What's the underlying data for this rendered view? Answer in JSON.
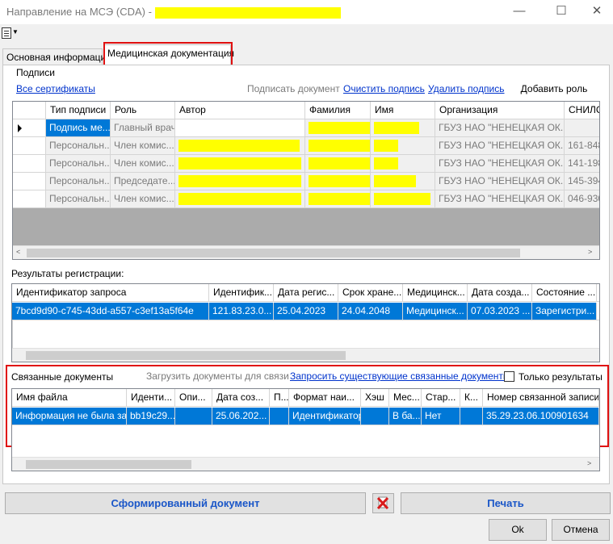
{
  "window": {
    "title": "Направление на МСЭ (CDA) -",
    "minimize": "—",
    "maximize": "☐",
    "close": "✕"
  },
  "tabs": [
    {
      "label": "Основная информация",
      "active": false
    },
    {
      "label": "Медицинская документация",
      "active": true
    }
  ],
  "signatures": {
    "group_title": "Подписи",
    "all_certificates": "Все сертификаты",
    "sign_document": "Подписать документ",
    "clear_signature": "Очистить подпись",
    "delete_signature": "Удалить подпись",
    "add_role": "Добавить роль",
    "columns": [
      "",
      "Тип подписи",
      "Роль",
      "Автор",
      "Фамилия",
      "Имя",
      "Организация",
      "СНИЛС"
    ],
    "rows": [
      {
        "type": "Подпись ме...",
        "role": "Главный врач",
        "org": "ГБУЗ НАО \"НЕНЕЦКАЯ ОК...",
        "snils": ""
      },
      {
        "type": "Персональн...",
        "role": "Член комис...",
        "org": "ГБУЗ НАО \"НЕНЕЦКАЯ ОК...",
        "snils": "161-848-"
      },
      {
        "type": "Персональн...",
        "role": "Член комис...",
        "org": "ГБУЗ НАО \"НЕНЕЦКАЯ ОК...",
        "snils": "141-198-"
      },
      {
        "type": "Персональн...",
        "role": "Председате...",
        "org": "ГБУЗ НАО \"НЕНЕЦКАЯ ОК...",
        "snils": "145-394-"
      },
      {
        "type": "Персональн...",
        "role": "Член комис...",
        "org": "ГБУЗ НАО \"НЕНЕЦКАЯ ОК...",
        "snils": "046-930-"
      }
    ]
  },
  "registration": {
    "group_title": "Результаты регистрации:",
    "columns": [
      "Идентификатор запроса",
      "Идентифик...",
      "Дата регис...",
      "Срок хране...",
      "Медицинск...",
      "Дата созда...",
      "Состояние ...",
      "Т"
    ],
    "rows": [
      [
        "7bcd9d90-c745-43dd-a557-c3ef13a5f64e",
        "121.83.23.0...",
        "25.04.2023",
        "24.04.2048",
        "Медицинск...",
        "07.03.2023 ...",
        "Зарегистри...",
        ""
      ]
    ]
  },
  "linked": {
    "group_title": "Связанные документы",
    "load_docs": "Загрузить документы для связи",
    "request_existing": "Запросить существующие связанные документы",
    "only_results": "Только результаты",
    "columns": [
      "Имя файла",
      "Иденти...",
      "Опи...",
      "Дата соз...",
      "П...",
      "Формат наи...",
      "Хэш",
      "Мес...",
      "Стар...",
      "К...",
      "Номер связанной записи ре"
    ],
    "rows": [
      [
        "Информация не была за...",
        "bb19c29...",
        "",
        "25.06.202...",
        "",
        "Идентификатор",
        "",
        "В ба...",
        "Нет",
        "",
        "35.29.23.06.100901634"
      ]
    ]
  },
  "footer": {
    "generated_doc": "Сформированный документ",
    "print": "Печать",
    "ok": "Ok",
    "cancel": "Отмена"
  },
  "colors": {
    "selection": "#0078d7",
    "link": "#0033cc",
    "highlight": "#ffff00",
    "annotation": "#e01010"
  }
}
